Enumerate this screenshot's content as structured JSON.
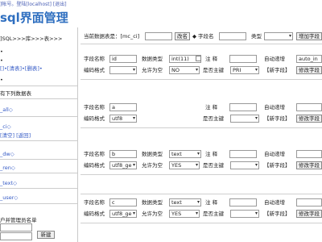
{
  "top_bar": {
    "text": "]帐号。登陆[localhost] [退出]"
  },
  "app": {
    "title": "sql界面管理"
  },
  "sidebar": {
    "path": "]SQL>>>库>>>表>>>",
    "items": [
      {
        "text": "•"
      },
      {
        "text": "•"
      },
      {
        "text": "[]•[清表]•[删表]•"
      },
      {
        "text": "•"
      },
      {
        "text": "有下列数据表"
      },
      {
        "text": "_all◇"
      },
      {
        "text": "_ci◇"
      },
      {
        "text": "[清空] [返回]"
      },
      {
        "text": "_dw◇"
      },
      {
        "text": "_ren◇"
      },
      {
        "text": "_text◇"
      },
      {
        "text": "_user◇"
      },
      {
        "text": "户并管理员名单"
      }
    ],
    "new_button": "新建"
  },
  "header": {
    "current_table_label": "当前数据表是：[mc_ci]",
    "rename_button": "改名",
    "field_name_label": "字段名",
    "type_label": "类型",
    "add_field_button": "增加字段"
  },
  "labels": {
    "field_name": "字段名称",
    "data_type": "数据类型",
    "comment": "注    释",
    "auto_increment": "自动递增",
    "encoding": "编码格式",
    "allow_null": "允许为空",
    "primary_key": "是否主键",
    "new_field": "【新字段】",
    "modify_field": "修改字段"
  },
  "rows": [
    {
      "name": "id",
      "type": "int(11)",
      "encoding": "",
      "allow_null": "NO",
      "primary": "PRI",
      "auto": "auto_in"
    },
    {
      "name": "a",
      "type": "",
      "encoding": "utf8",
      "allow_null": "",
      "primary": "",
      "auto": ""
    },
    {
      "name": "b",
      "type": "text",
      "encoding": "utf8_ge",
      "allow_null": "YES",
      "primary": "",
      "auto": ""
    },
    {
      "name": "c",
      "type": "text",
      "encoding": "utf8_ge",
      "allow_null": "YES",
      "primary": "",
      "auto": ""
    }
  ]
}
